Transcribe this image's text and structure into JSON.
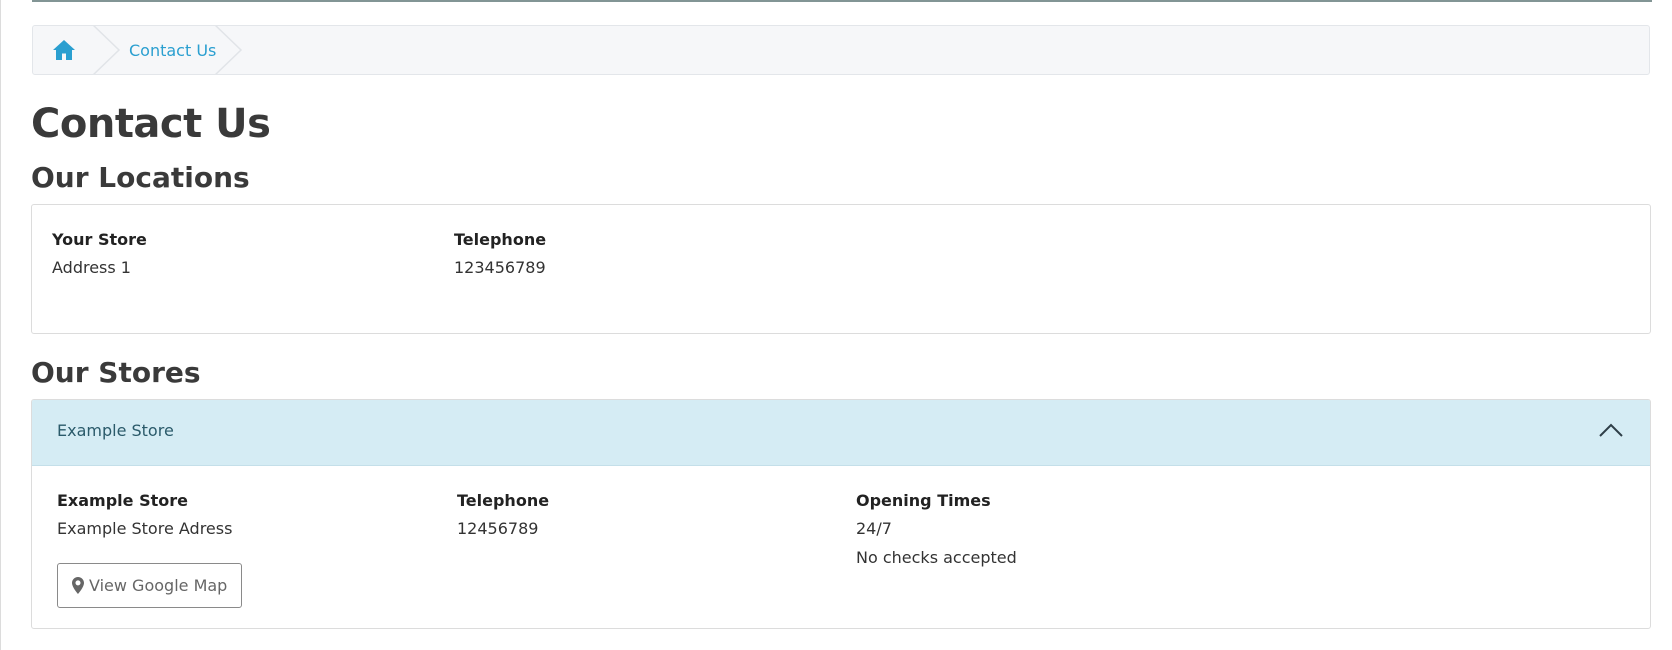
{
  "breadcrumb": {
    "home_icon": "home-icon",
    "current": "Contact Us"
  },
  "page": {
    "title": "Contact Us"
  },
  "locations": {
    "heading": "Our Locations",
    "store_label": "Your Store",
    "store_address": "Address 1",
    "telephone_label": "Telephone",
    "telephone_value": "123456789"
  },
  "stores": {
    "heading": "Our Stores",
    "items": [
      {
        "header": "Example Store",
        "expanded": true,
        "name_label": "Example Store",
        "address": "Example Store Adress",
        "telephone_label": "Telephone",
        "telephone_value": "12456789",
        "hours_label": "Opening Times",
        "hours_value": "24/7",
        "hours_note": "No checks accepted",
        "map_button": "View Google Map",
        "map_icon": "map-marker-icon"
      }
    ]
  },
  "colors": {
    "link": "#2a9fd0",
    "accordion_header_bg": "#d5ecf4",
    "breadcrumb_bg": "#f6f7f9"
  }
}
